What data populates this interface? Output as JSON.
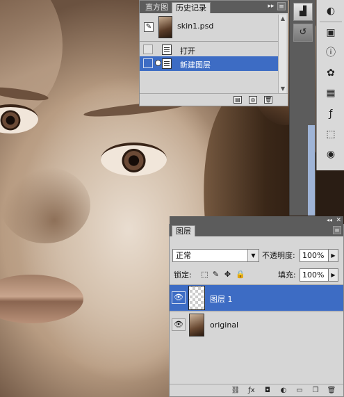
{
  "history_panel": {
    "tabs": [
      {
        "label": "直方图"
      },
      {
        "label": "历史记录"
      }
    ],
    "snapshot_name": "skin1.psd",
    "steps": [
      {
        "label": "打开",
        "selected": false
      },
      {
        "label": "新建图层",
        "selected": true
      }
    ]
  },
  "layers_panel": {
    "tab": "图层",
    "blend_mode": "正常",
    "opacity_label": "不透明度:",
    "opacity_value": "100%",
    "lock_label": "锁定:",
    "fill_label": "填充:",
    "fill_value": "100%",
    "layers": [
      {
        "name": "图层 1",
        "selected": true,
        "thumb": "transparent"
      },
      {
        "name": "original",
        "selected": false,
        "thumb": "photo"
      }
    ]
  },
  "colors": {
    "selection": "#3d6cc4",
    "panel_bg": "#d6d6d6",
    "tabbar_bg": "#5c5c5c"
  }
}
